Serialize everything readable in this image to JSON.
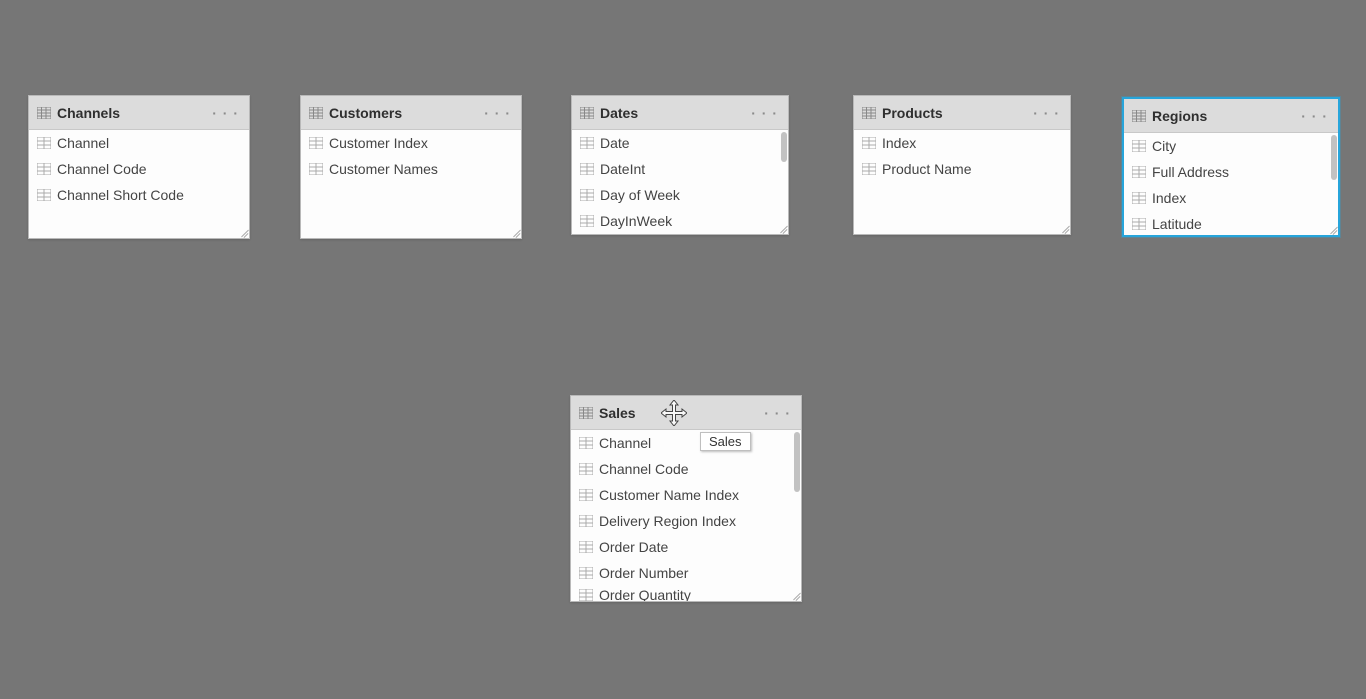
{
  "glyphs": {
    "more": "· · ·"
  },
  "tooltip": {
    "text": "Sales"
  },
  "tables": {
    "channels": {
      "title": "Channels",
      "fields": [
        "Channel",
        "Channel Code",
        "Channel Short Code"
      ]
    },
    "customers": {
      "title": "Customers",
      "fields": [
        "Customer Index",
        "Customer Names"
      ]
    },
    "dates": {
      "title": "Dates",
      "fields": [
        "Date",
        "DateInt",
        "Day of Week",
        "DayInWeek"
      ]
    },
    "products": {
      "title": "Products",
      "fields": [
        "Index",
        "Product Name"
      ]
    },
    "regions": {
      "title": "Regions",
      "fields": [
        "City",
        "Full Address",
        "Index",
        "Latitude"
      ]
    },
    "sales": {
      "title": "Sales",
      "fields": [
        "Channel",
        "Channel Code",
        "Customer Name Index",
        "Delivery Region Index",
        "Order Date",
        "Order Number",
        "Order Quantity"
      ]
    }
  }
}
